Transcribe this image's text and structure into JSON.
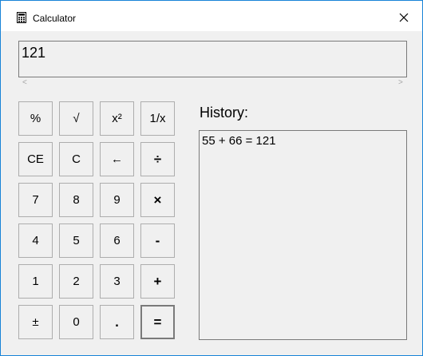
{
  "window": {
    "title": "Calculator",
    "icon": "calculator-icon"
  },
  "display": {
    "value": "121"
  },
  "scroll": {
    "left": "<",
    "right": ">"
  },
  "keypad": {
    "percent": "%",
    "sqrt": "√",
    "square": "x²",
    "reciprocal": "1/x",
    "clear_entry": "CE",
    "clear": "C",
    "backspace": "←",
    "divide": "÷",
    "seven": "7",
    "eight": "8",
    "nine": "9",
    "multiply": "×",
    "four": "4",
    "five": "5",
    "six": "6",
    "minus": "-",
    "one": "1",
    "two": "2",
    "three": "3",
    "plus": "+",
    "negate": "±",
    "zero": "0",
    "decimal": ".",
    "equals": "="
  },
  "history": {
    "label": "History:",
    "items": [
      "55 + 66 = 121"
    ]
  }
}
